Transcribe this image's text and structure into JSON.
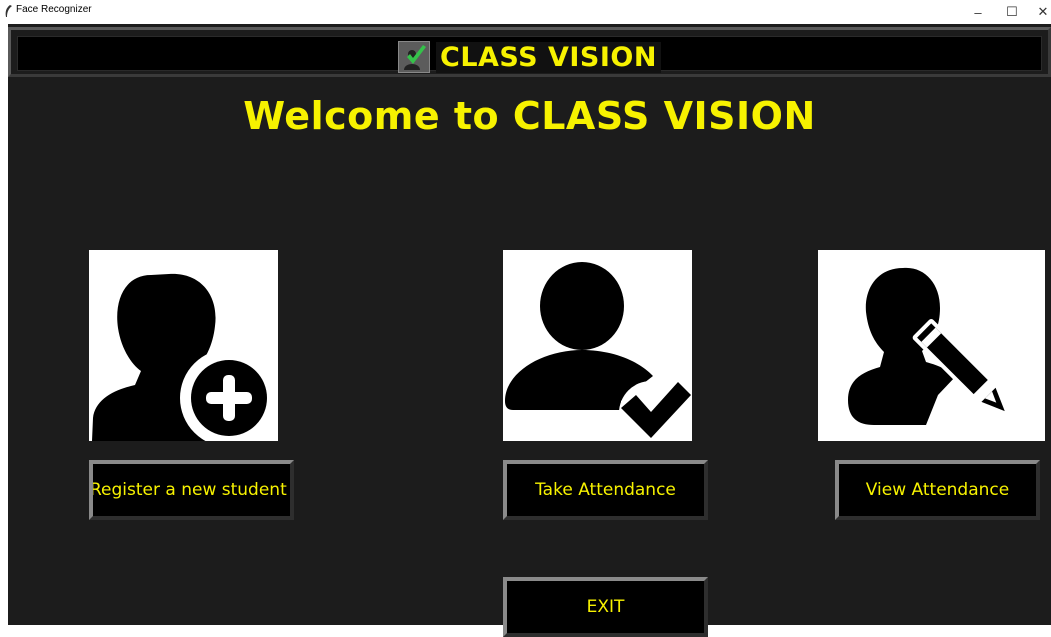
{
  "window": {
    "title": "Face Recognizer",
    "minimize_glyph": "–",
    "maximize_glyph": "☐",
    "close_glyph": "✕"
  },
  "header": {
    "title": "CLASS VISION",
    "logo_icon": "attendance-check-icon"
  },
  "welcome_text": "Welcome to CLASS VISION",
  "tiles": {
    "register": {
      "icon": "user-add-icon"
    },
    "take": {
      "icon": "user-check-icon"
    },
    "view": {
      "icon": "user-edit-icon"
    }
  },
  "buttons": {
    "register_label": "Register a new student",
    "take_label": "Take Attendance",
    "view_label": "View Attendance",
    "exit_label": "EXIT"
  },
  "colors": {
    "background": "#1c1c1c",
    "accent_yellow": "#f7f200",
    "button_bg": "#000000",
    "tile_bg": "#ffffff"
  }
}
